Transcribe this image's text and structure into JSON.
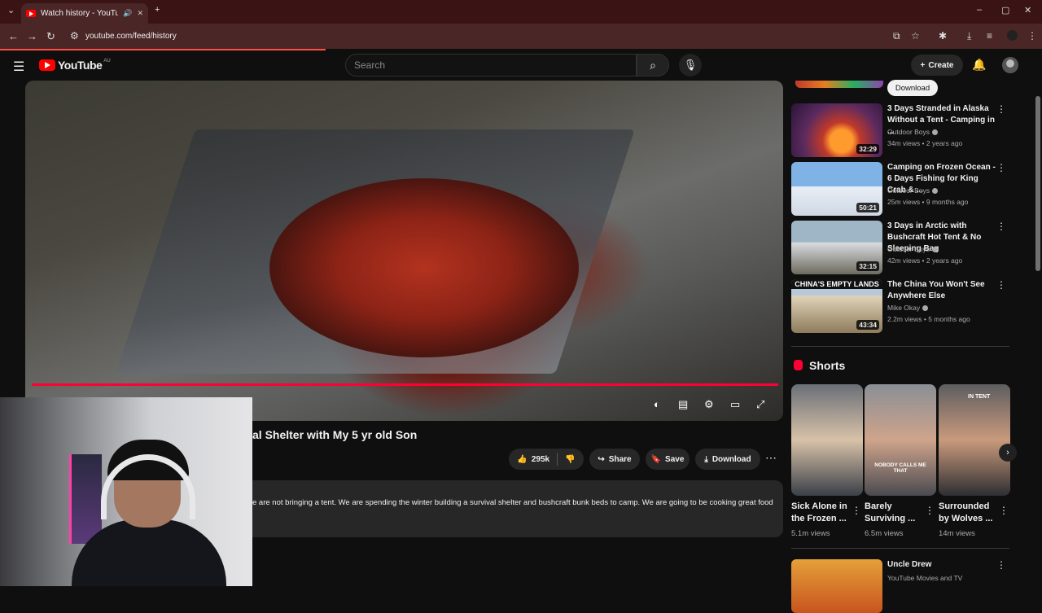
{
  "browser": {
    "tab_title": "Watch history - YouTube",
    "url": "youtube.com/feed/history"
  },
  "header": {
    "logo_text": "YouTube",
    "region": "AU",
    "search_placeholder": "Search",
    "create_label": "Create"
  },
  "video": {
    "title": "al Shelter with My 5 yr old Son",
    "likes": "295k",
    "share_label": "Share",
    "save_label": "Save",
    "download_label": "Download",
    "description": "e are not bringing a tent. We are spending the winter building a survival shelter and bushcraft bunk beds to camp.  We are going to be cooking great food,"
  },
  "sidebar": {
    "download_pill": "Download",
    "recommendations": [
      {
        "title": "3 Days Stranded in Alaska Without a Tent - Camping in ...",
        "channel": "Outdoor Boys",
        "meta": "34m views • 2 years ago",
        "duration": "32:29"
      },
      {
        "title": "Camping on Frozen Ocean - 6 Days Fishing for King Crab & ...",
        "channel": "Outdoor Boys",
        "meta": "25m views • 9 months ago",
        "duration": "50:21"
      },
      {
        "title": "3 Days in Arctic with Bushcraft Hot Tent & No Sleeping Bag",
        "channel": "Outdoor Boys",
        "meta": "42m views • 2 years ago",
        "duration": "32:15"
      },
      {
        "title": "The China You Won't See Anywhere Else",
        "channel": "Mike Okay",
        "meta": "2.2m views • 5 months ago",
        "duration": "43:34",
        "thumb_text": "CHINA'S EMPTY LANDS"
      }
    ],
    "shorts_label": "Shorts",
    "shorts": [
      {
        "title": "Sick Alone in the Frozen ...",
        "views": "5.1m views"
      },
      {
        "title": "Barely Surviving ...",
        "views": "6.5m views",
        "overlay": "NOBODY CALLS ME THAT"
      },
      {
        "title": "Surrounded by Wolves ...",
        "views": "14m views",
        "overlay": "IN TENT"
      }
    ],
    "next_video": {
      "title": "Uncle Drew",
      "channel": "YouTube Movies and TV"
    }
  }
}
